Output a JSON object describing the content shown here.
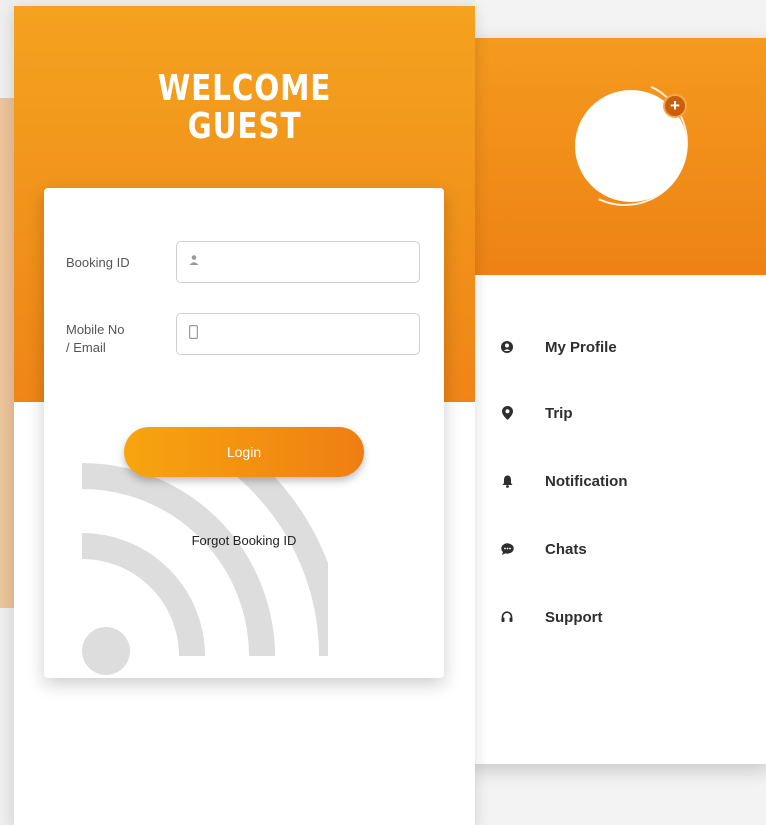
{
  "colors": {
    "accent": "#ef8516",
    "accent_light": "#f4a21f",
    "avatar_badge": "#c95f0a"
  },
  "login": {
    "welcome_line1": "WELCOME",
    "welcome_line2": "GUEST",
    "fields": {
      "booking_id": {
        "label": "Booking ID",
        "value": "",
        "icon": "user-icon"
      },
      "mobile_email": {
        "label_line1": "Mobile No",
        "label_line2": "/ Email",
        "value": "",
        "icon": "phone-icon"
      }
    },
    "login_button": "Login",
    "forgot_link": "Forgot Booking ID",
    "watermark_icon": "wifi-icon"
  },
  "menu": {
    "avatar_add_icon": "plus-icon",
    "avatar_add_glyph": "+",
    "items": [
      {
        "label": "My Profile",
        "icon": "profile-icon"
      },
      {
        "label": "Trip",
        "icon": "location-pin-icon"
      },
      {
        "label": "Notification",
        "icon": "bell-icon"
      },
      {
        "label": "Chats",
        "icon": "chat-icon"
      },
      {
        "label": "Support",
        "icon": "headset-icon"
      }
    ]
  }
}
